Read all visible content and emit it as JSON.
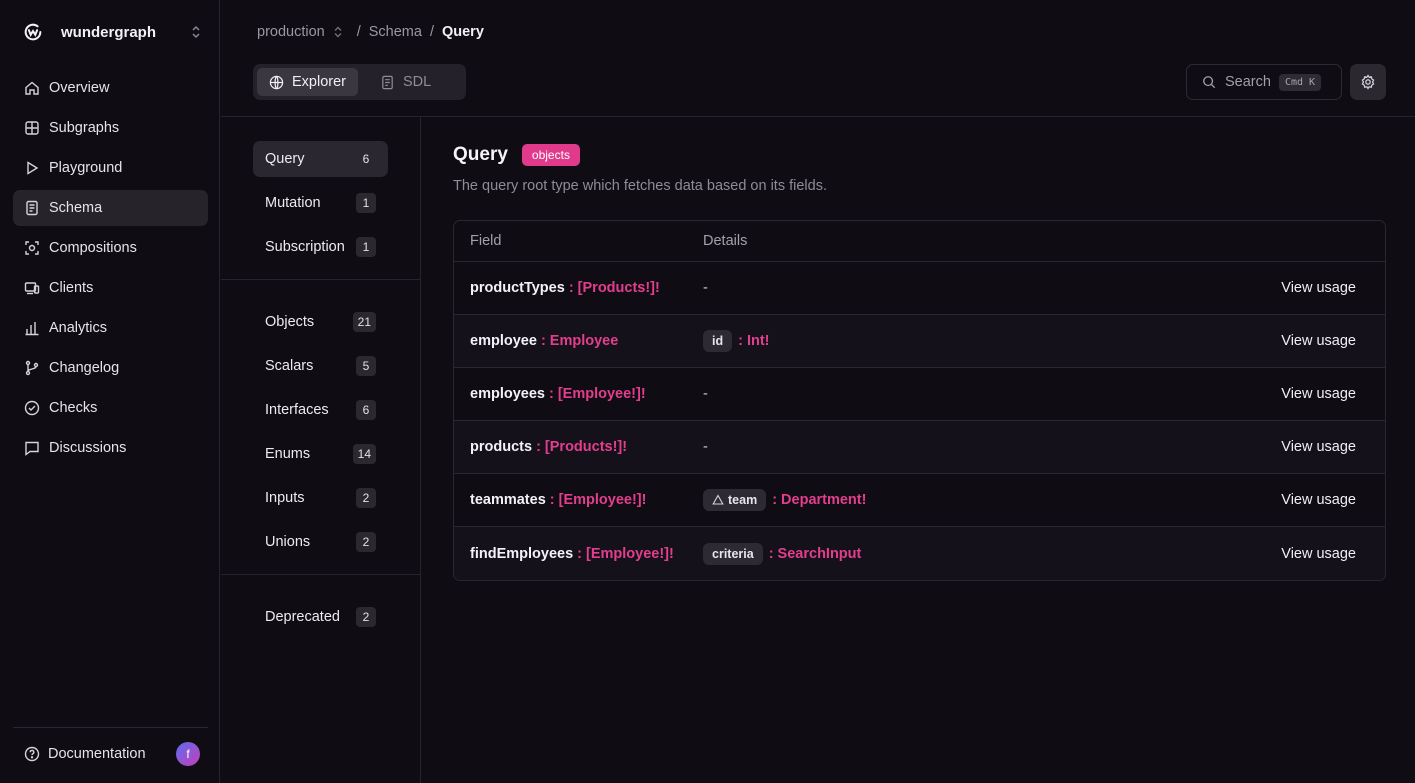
{
  "org": {
    "name": "wundergraph"
  },
  "nav": [
    {
      "label": "Overview",
      "icon": "home-icon"
    },
    {
      "label": "Subgraphs",
      "icon": "grid-icon"
    },
    {
      "label": "Playground",
      "icon": "play-icon"
    },
    {
      "label": "Schema",
      "icon": "file-icon",
      "active": true
    },
    {
      "label": "Compositions",
      "icon": "compositions-icon"
    },
    {
      "label": "Clients",
      "icon": "clients-icon"
    },
    {
      "label": "Analytics",
      "icon": "chart-icon"
    },
    {
      "label": "Changelog",
      "icon": "git-branch-icon"
    },
    {
      "label": "Checks",
      "icon": "check-circle-icon"
    },
    {
      "label": "Discussions",
      "icon": "chat-icon"
    }
  ],
  "footer": {
    "documentation": "Documentation",
    "avatar_initial": "f"
  },
  "breadcrumb": {
    "graph": "production",
    "sep": "/",
    "schema": "Schema",
    "current": "Query"
  },
  "view_toggle": {
    "explorer": "Explorer",
    "sdl": "SDL"
  },
  "search": {
    "label": "Search",
    "shortcut": "Cmd K"
  },
  "type_groups": {
    "roots": [
      {
        "label": "Query",
        "count": "6",
        "active": true
      },
      {
        "label": "Mutation",
        "count": "1"
      },
      {
        "label": "Subscription",
        "count": "1"
      }
    ],
    "kinds": [
      {
        "label": "Objects",
        "count": "21"
      },
      {
        "label": "Scalars",
        "count": "5"
      },
      {
        "label": "Interfaces",
        "count": "6"
      },
      {
        "label": "Enums",
        "count": "14"
      },
      {
        "label": "Inputs",
        "count": "2"
      },
      {
        "label": "Unions",
        "count": "2"
      }
    ],
    "other": [
      {
        "label": "Deprecated",
        "count": "2"
      }
    ]
  },
  "main": {
    "title": "Query",
    "badge": "objects",
    "description": "The query root type which fetches data based on its fields.",
    "columns": {
      "field": "Field",
      "details": "Details"
    },
    "usage_label": "View usage",
    "fields": [
      {
        "name": "productTypes",
        "type": ": [Products!]!",
        "details": "-"
      },
      {
        "name": "employee",
        "type": ": Employee",
        "arg": "id",
        "arg_type": ": Int!"
      },
      {
        "name": "employees",
        "type": ": [Employee!]!",
        "details": "-"
      },
      {
        "name": "products",
        "type": ": [Products!]!",
        "details": "-"
      },
      {
        "name": "teammates",
        "type": ": [Employee!]!",
        "arg": "team",
        "arg_icon": "warning-icon",
        "arg_type": ": Department!"
      },
      {
        "name": "findEmployees",
        "type": ": [Employee!]!",
        "arg": "criteria",
        "arg_type": ": SearchInput"
      }
    ]
  },
  "colors": {
    "accent": "#e13a8c",
    "background": "#0f0c13"
  }
}
